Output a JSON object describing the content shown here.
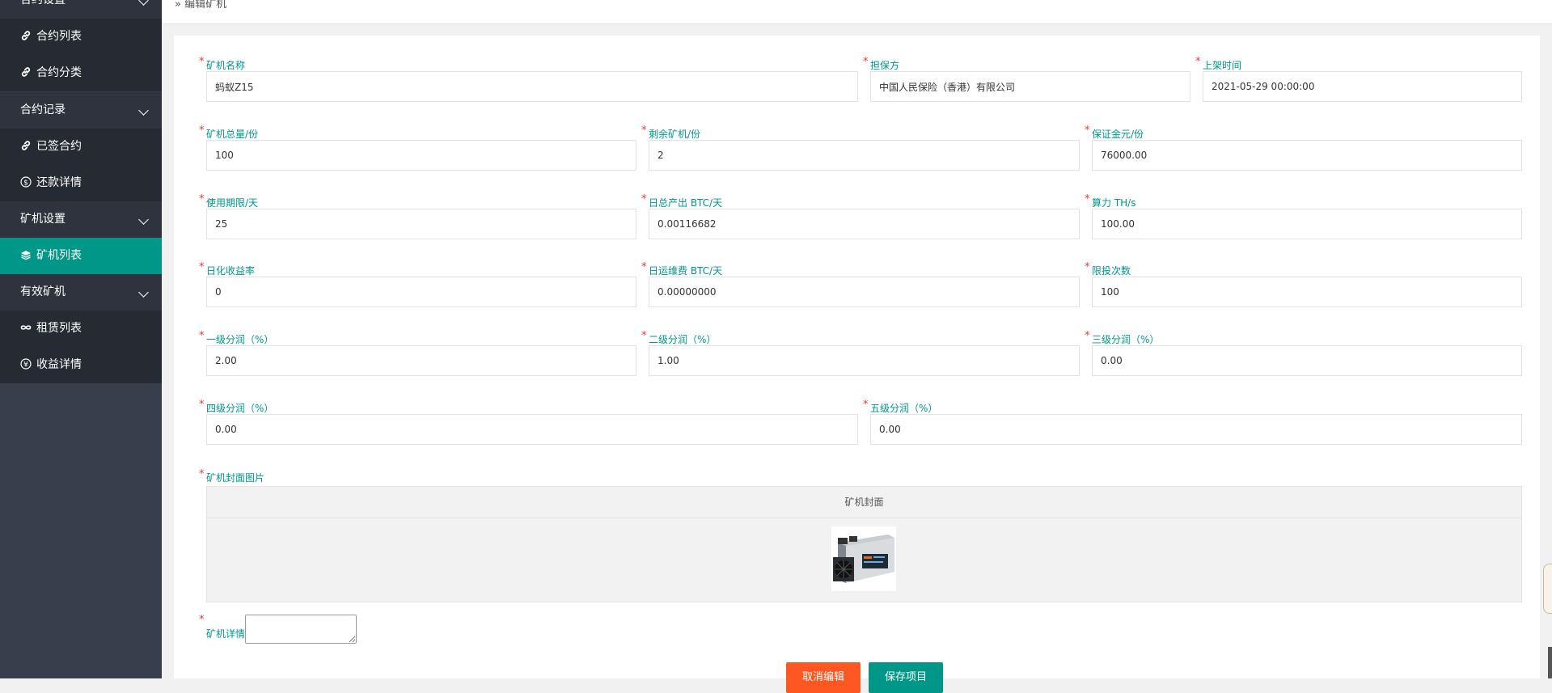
{
  "sidebar": {
    "groups": {
      "contract_settings": "合约设置",
      "contract_records": "合约记录",
      "miner_settings": "矿机设置",
      "active_miners": "有效矿机"
    },
    "items": {
      "contract_list": "合约列表",
      "contract_category": "合约分类",
      "signed_contracts": "已签合约",
      "repayment_details": "还款详情",
      "miner_list": "矿机列表",
      "lease_list": "租赁列表",
      "earnings_details": "收益详情"
    },
    "icons": {
      "contract_list": "link-icon",
      "contract_category": "link-icon",
      "signed_contracts": "link-icon",
      "repayment_details": "dollar-circle-icon",
      "miner_list": "layers-icon",
      "lease_list": "infinity-icon",
      "earnings_details": "yen-circle-icon"
    },
    "active_color": "#009688"
  },
  "breadcrumb": {
    "separator": "»",
    "title": "编辑矿机"
  },
  "form": {
    "required_mark": "*",
    "miner_name": {
      "label": "矿机名称",
      "value": "蚂蚁Z15"
    },
    "guarantor": {
      "label": "担保方",
      "value": "中国人民保险（香港）有限公司"
    },
    "listing_time": {
      "label": "上架时间",
      "value": "2021-05-29 00:00:00"
    },
    "total_shares": {
      "label": "矿机总量/份",
      "value": "100"
    },
    "remaining_shares": {
      "label": "剩余矿机/份",
      "value": "2"
    },
    "deposit": {
      "label": "保证金元/份",
      "value": "76000.00"
    },
    "term_days": {
      "label": "使用期限/天",
      "value": "25"
    },
    "daily_output": {
      "label": "日总产出 BTC/天",
      "value": "0.00116682"
    },
    "hashrate": {
      "label": "算力 TH/s",
      "value": "100.00"
    },
    "daily_yield": {
      "label": "日化收益率",
      "value": "0"
    },
    "daily_maintenance": {
      "label": "日运维费 BTC/天",
      "value": "0.00000000"
    },
    "purchase_limit": {
      "label": "限投次数",
      "value": "100"
    },
    "level1": {
      "label": "一级分润（%）",
      "value": "2.00"
    },
    "level2": {
      "label": "二级分润（%）",
      "value": "1.00"
    },
    "level3": {
      "label": "三级分润（%）",
      "value": "0.00"
    },
    "level4": {
      "label": "四级分润（%）",
      "value": "0.00"
    },
    "level5": {
      "label": "五级分润（%）",
      "value": "0.00"
    },
    "cover_image": {
      "label": "矿机封面图片",
      "column_header": "矿机封面"
    },
    "details": {
      "label": "矿机详情"
    }
  },
  "buttons": {
    "cancel": "取消编辑",
    "save": "保存项目"
  },
  "colors": {
    "label": "#009688",
    "required": "#e4393c",
    "cancel": "#ff5722",
    "save": "#009688"
  }
}
